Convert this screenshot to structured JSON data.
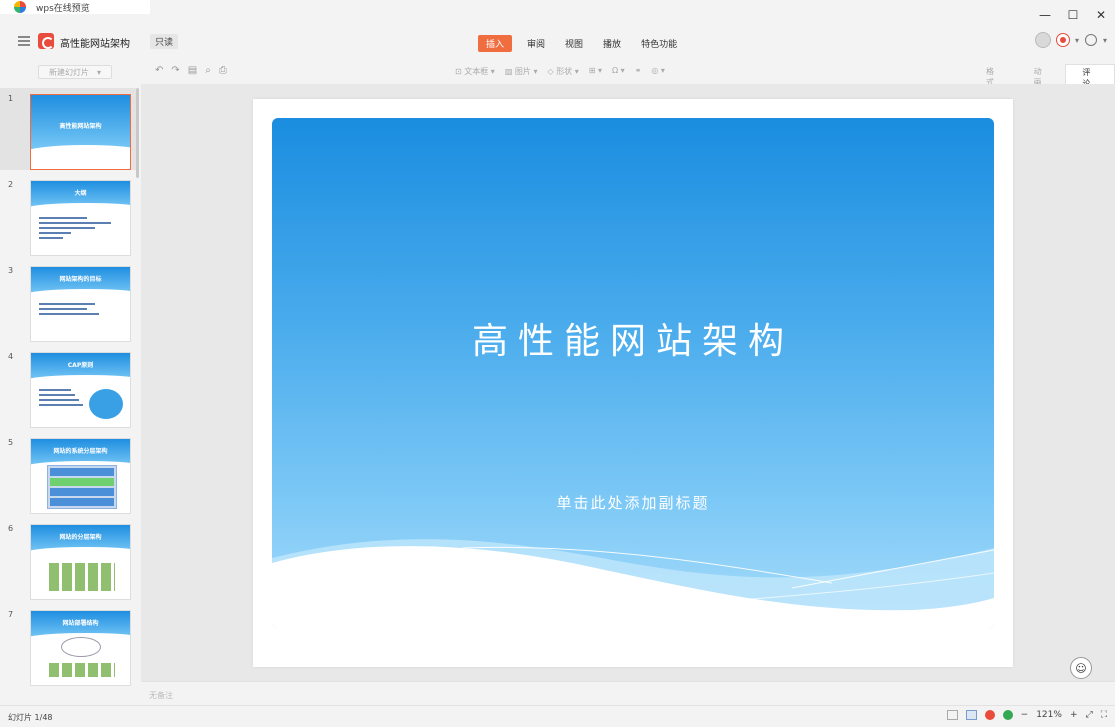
{
  "window": {
    "tab_title": "wps在线预览",
    "controls": [
      "—",
      "☐",
      "✕"
    ]
  },
  "menubar": {
    "doc_title": "高性能网站架构",
    "readonly_badge": "只读",
    "items": [
      "插入",
      "审阅",
      "视图",
      "播放",
      "特色功能"
    ],
    "active_item": "插入"
  },
  "toolbar": {
    "new_slide": "新建幻灯片",
    "center_tools": [
      "文本框",
      "图片",
      "形状",
      "表格",
      "符号",
      "链接",
      "其他"
    ],
    "right_tabs": [
      "格式",
      "动画",
      "评论"
    ],
    "active_right_tab": "评论"
  },
  "thumbnails": [
    {
      "num": "1",
      "title": "高性能网站架构"
    },
    {
      "num": "2",
      "title": "大纲"
    },
    {
      "num": "3",
      "title": "网站架构的目标"
    },
    {
      "num": "4",
      "title": "CAP原则"
    },
    {
      "num": "5",
      "title": "网站的系统分层架构"
    },
    {
      "num": "6",
      "title": "网站的分层架构"
    },
    {
      "num": "7",
      "title": "网站部署结构"
    }
  ],
  "slide": {
    "title": "高性能网站架构",
    "subtitle": "单击此处添加副标题"
  },
  "notes_placeholder": "无备注",
  "status": {
    "slide_count": "幻灯片 1/48",
    "zoom": "121%"
  }
}
